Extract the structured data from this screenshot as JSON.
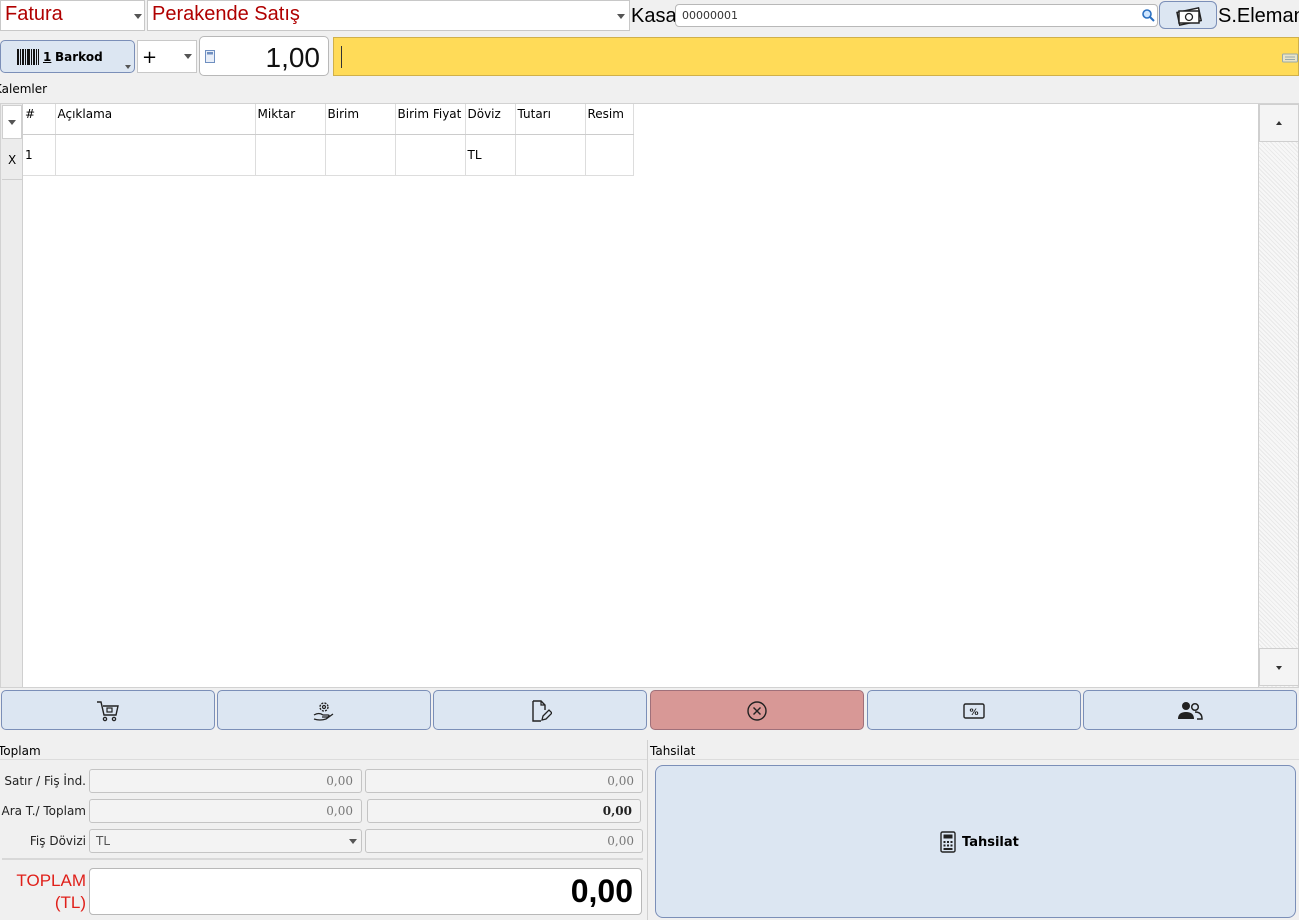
{
  "header": {
    "doc_type": "Fatura",
    "sale_type": "Perakende Satış",
    "kasa_label": "Kasa",
    "kasa_value": "00000001",
    "salesperson_label": "S.Eleman"
  },
  "entry": {
    "barcode_hotkey": "1",
    "barcode_label": "Barkod",
    "operator": "+",
    "quantity": "1,00"
  },
  "items_section": {
    "title": "Kalemler",
    "columns": [
      "#",
      "Açıklama",
      "Miktar",
      "Birim",
      "Birim Fiyat",
      "Döviz",
      "Tutarı",
      "Resim"
    ],
    "rows": [
      {
        "marker": "X",
        "no": "1",
        "aciklama": "",
        "miktar": "",
        "birim": "",
        "birim_fiyat": "",
        "doviz": "TL",
        "tutari": "",
        "resim": ""
      }
    ]
  },
  "actions": {
    "icons": [
      "cart-icon",
      "service-icon",
      "document-edit-icon",
      "cancel-icon",
      "discount-icon",
      "customers-icon"
    ],
    "cancel_color": "#d89896"
  },
  "totals": {
    "title": "Toplam",
    "row1_label": "Satır / Fiş İnd.",
    "row1_val1": "0,00",
    "row1_val2": "0,00",
    "row2_label": "Ara T./ Toplam",
    "row2_val1": "0,00",
    "row2_val2": "0,00",
    "row3_label": "Fiş Dövizi",
    "row3_currency": "TL",
    "row3_val2": "0,00",
    "grand_label_line1": "TOPLAM",
    "grand_label_line2": "(TL)",
    "grand_value": "0,00"
  },
  "payment": {
    "title": "Tahsilat",
    "button_label": "Tahsilat"
  },
  "colors": {
    "accent_yellow": "#ffdb58",
    "label_red": "#b00000",
    "grand_red": "#e0201a",
    "button_blue": "#dce6f2"
  }
}
